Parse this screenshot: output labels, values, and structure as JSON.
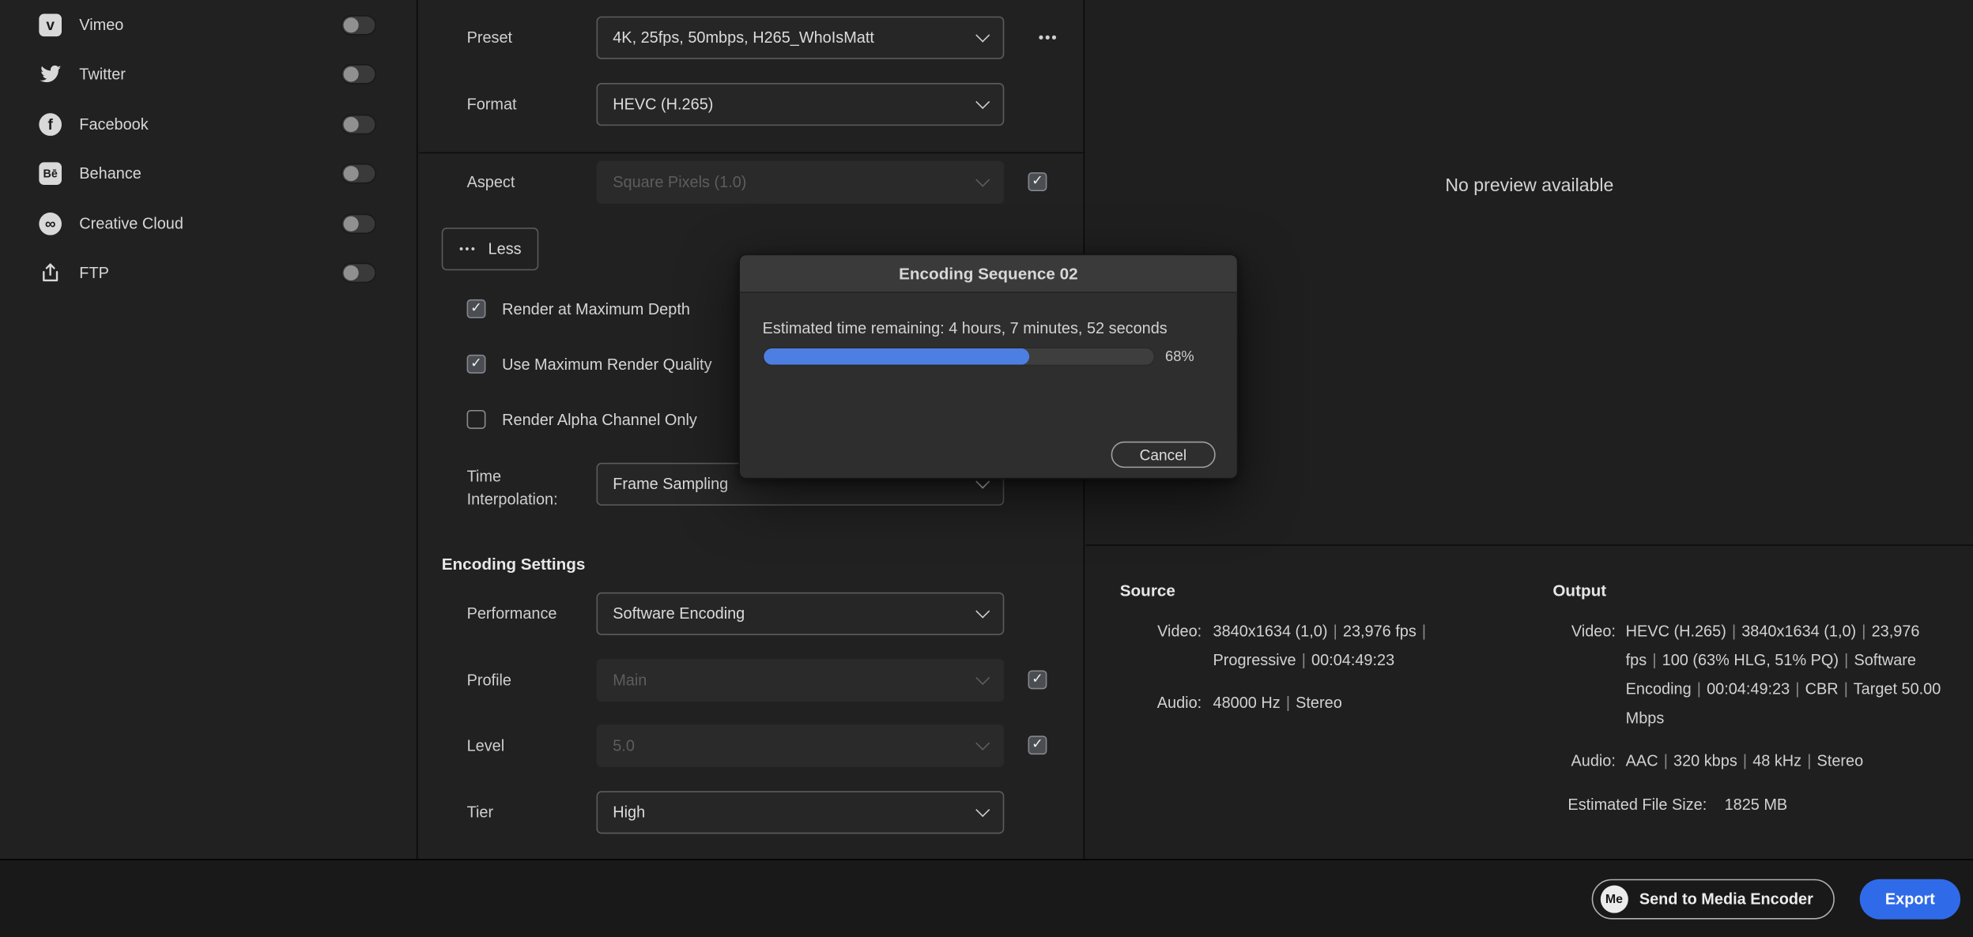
{
  "sidebar": {
    "items": [
      {
        "label": "Vimeo",
        "enabled": false
      },
      {
        "label": "Twitter",
        "enabled": false
      },
      {
        "label": "Facebook",
        "enabled": false
      },
      {
        "label": "Behance",
        "enabled": false
      },
      {
        "label": "Creative Cloud",
        "enabled": false
      },
      {
        "label": "FTP",
        "enabled": false
      }
    ]
  },
  "icons": {
    "vimeo": "v",
    "facebook": "f",
    "behance": "Bē",
    "creative_cloud": "∞",
    "ellipsis": "•••"
  },
  "settings": {
    "preset": {
      "label": "Preset",
      "value": "4K, 25fps, 50mbps, H265_WhoIsMatt"
    },
    "format": {
      "label": "Format",
      "value": "HEVC (H.265)"
    },
    "aspect": {
      "label": "Aspect",
      "value": "Square Pixels (1.0)",
      "checked": true,
      "disabled": true
    },
    "less_button": {
      "label": "Less"
    },
    "checkboxes": [
      {
        "label": "Render at Maximum Depth",
        "checked": true
      },
      {
        "label": "Use Maximum Render Quality",
        "checked": true
      },
      {
        "label": "Render Alpha Channel Only",
        "checked": false
      }
    ],
    "time_interpolation": {
      "label": "Time Interpolation:",
      "value": "Frame Sampling"
    },
    "encoding_heading": "Encoding Settings",
    "performance": {
      "label": "Performance",
      "value": "Software Encoding"
    },
    "profile": {
      "label": "Profile",
      "value": "Main",
      "checked": true,
      "disabled": true
    },
    "level": {
      "label": "Level",
      "value": "5.0",
      "checked": true,
      "disabled": true
    },
    "tier": {
      "label": "Tier",
      "value": "High"
    }
  },
  "dialog": {
    "title": "Encoding Sequence 02",
    "status": "Estimated time remaining: 4 hours, 7 minutes, 52 seconds",
    "progress_percent": 68,
    "progress_label": "68%",
    "cancel_label": "Cancel"
  },
  "preview": {
    "empty_text": "No preview available"
  },
  "summary": {
    "source": {
      "heading": "Source",
      "video_label": "Video:",
      "video_value": "3840x1634 (1,0) | 23,976 fps | Progressive | 00:04:49:23",
      "audio_label": "Audio:",
      "audio_value": "48000 Hz | Stereo"
    },
    "output": {
      "heading": "Output",
      "video_label": "Video:",
      "video_value": "HEVC (H.265) | 3840x1634 (1,0) | 23,976 fps | 100 (63% HLG, 51% PQ) | Software Encoding | 00:04:49:23 | CBR | Target 50.00 Mbps",
      "audio_label": "Audio:",
      "audio_value": "AAC | 320 kbps | 48 kHz | Stereo",
      "file_size_label": "Estimated File Size:",
      "file_size_value": "1825 MB"
    }
  },
  "footer": {
    "send_to_media_encoder": "Send to Media Encoder",
    "me_badge": "Me",
    "export_label": "Export"
  },
  "colors": {
    "accent_blue": "#2f6ae8",
    "progress_blue": "#4c7fe1"
  }
}
